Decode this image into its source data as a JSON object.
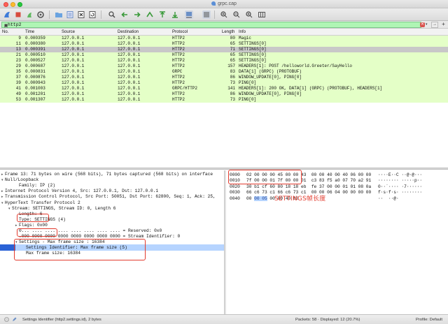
{
  "window": {
    "title": "grpc.cap"
  },
  "filter": {
    "value": "http2"
  },
  "packet_list": {
    "columns": [
      "No.",
      "Time",
      "Source",
      "Destination",
      "Protocol",
      "Length",
      "Info"
    ],
    "rows": [
      {
        "no": "9",
        "time": "0.000359",
        "src": "127.0.0.1",
        "dst": "127.0.0.1",
        "proto": "HTTP2",
        "len": "80",
        "info": "Magic"
      },
      {
        "no": "11",
        "time": "0.000380",
        "src": "127.0.0.1",
        "dst": "127.0.0.1",
        "proto": "HTTP2",
        "len": "65",
        "info": "SETTINGS[0]"
      },
      {
        "no": "13",
        "time": "0.000391",
        "src": "127.0.0.1",
        "dst": "127.0.0.1",
        "proto": "HTTP2",
        "len": "71",
        "info": "SETTINGS[0]"
      },
      {
        "no": "21",
        "time": "0.000510",
        "src": "127.0.0.1",
        "dst": "127.0.0.1",
        "proto": "HTTP2",
        "len": "65",
        "info": "SETTINGS[0]"
      },
      {
        "no": "23",
        "time": "0.000527",
        "src": "127.0.0.1",
        "dst": "127.0.0.1",
        "proto": "HTTP2",
        "len": "65",
        "info": "SETTINGS[0]"
      },
      {
        "no": "29",
        "time": "0.000687",
        "src": "127.0.0.1",
        "dst": "127.0.0.1",
        "proto": "HTTP2",
        "len": "157",
        "info": "HEADERS[1]: POST /helloworld.Greeter/SayHello"
      },
      {
        "no": "35",
        "time": "0.000831",
        "src": "127.0.0.1",
        "dst": "127.0.0.1",
        "proto": "GRPC",
        "len": "83",
        "info": "DATA[1] (GRPC) (PROTOBUF)"
      },
      {
        "no": "37",
        "time": "0.000876",
        "src": "127.0.0.1",
        "dst": "127.0.0.1",
        "proto": "HTTP2",
        "len": "86",
        "info": "WINDOW_UPDATE[0], PING[0]"
      },
      {
        "no": "39",
        "time": "0.000943",
        "src": "127.0.0.1",
        "dst": "127.0.0.1",
        "proto": "HTTP2",
        "len": "73",
        "info": "PING[0]"
      },
      {
        "no": "41",
        "time": "0.001003",
        "src": "127.0.0.1",
        "dst": "127.0.0.1",
        "proto": "GRPC/HTTP2",
        "len": "141",
        "info": "HEADERS[1]: 200 OK, DATA[1] (GRPC) (PROTOBUF), HEADERS[1]"
      },
      {
        "no": "49",
        "time": "0.001201",
        "src": "127.0.0.1",
        "dst": "127.0.0.1",
        "proto": "HTTP2",
        "len": "86",
        "info": "WINDOW_UPDATE[0], PING[0]"
      },
      {
        "no": "53",
        "time": "0.001307",
        "src": "127.0.0.1",
        "dst": "127.0.0.1",
        "proto": "HTTP2",
        "len": "73",
        "info": "PING[0]"
      }
    ]
  },
  "details": {
    "lines": [
      {
        "tri": "▸",
        "indent": 0,
        "text": "Frame 13: 71 bytes on wire (568 bits), 71 bytes captured (568 bits) on interface"
      },
      {
        "tri": "▾",
        "indent": 0,
        "text": "Null/Loopback"
      },
      {
        "tri": "",
        "indent": 2,
        "text": "Family: IP (2)"
      },
      {
        "tri": "▸",
        "indent": 0,
        "text": "Internet Protocol Version 4, Src: 127.0.0.1, Dst: 127.0.0.1"
      },
      {
        "tri": "▸",
        "indent": 0,
        "text": "Transmission Control Protocol, Src Port: 50051, Dst Port: 62800, Seq: 1, Ack: 25,"
      },
      {
        "tri": "▾",
        "indent": 0,
        "text": "HyperText Transfer Protocol 2"
      },
      {
        "tri": "▾",
        "indent": 1,
        "text": "Stream: SETTINGS, Stream ID: 0, Length 6"
      },
      {
        "tri": "",
        "indent": 2,
        "text": "Length: 6"
      },
      {
        "tri": "",
        "indent": 2,
        "text": "Type: SETTINGS (4)"
      },
      {
        "tri": "▸",
        "indent": 2,
        "text": "Flags: 0x00"
      },
      {
        "tri": "",
        "indent": 2,
        "text": "0... .... .... .... .... .... .... .... = Reserved: 0x0"
      },
      {
        "tri": "",
        "indent": 2,
        "text": ".000 0000 0000 0000 0000 0000 0000 0000 = Stream Identifier: 0"
      },
      {
        "tri": "▾",
        "indent": 2,
        "text": "Settings - Max frame size : 16384"
      },
      {
        "tri": "",
        "indent": 3,
        "text": "Settings Identifier: Max frame size (5)"
      },
      {
        "tri": "",
        "indent": 3,
        "text": "Max frame size: 16384"
      }
    ]
  },
  "hex": {
    "lines": [
      {
        "off": "0000",
        "pre": "02 00 00 00 45 00 00 43  00 00 40 00 40 06 00 00",
        "hl": "",
        "post": "",
        "ascii": "····E··C ··@·@···"
      },
      {
        "off": "0010",
        "pre": "7f 00 00 01 7f 00 00 01  c3 83 f5 a0 07 70 a2 91",
        "hl": "",
        "post": "",
        "ascii": "········ ·····p··"
      },
      {
        "off": "0020",
        "pre": "30 b1 cf 60 80 18 18 eb  fe 37 00 00 01 01 08 0a",
        "hl": "",
        "post": "",
        "ascii": "0··`···· ·7······"
      },
      {
        "off": "0030",
        "pre": "66 c6 73 c1 66 c6 73 c1  00 00 06 04 00 00 00 00",
        "hl": "",
        "post": "",
        "ascii": "f·s·f·s· ········"
      },
      {
        "off": "0040",
        "pre": "00 ",
        "hl": "00 05",
        "post": " 00 00 40 00",
        "ascii": "··  ··@·"
      }
    ]
  },
  "annotation": {
    "text": "SETTINGS帧长度"
  },
  "status": {
    "left": "Settings Identifier (http2.settings.id), 2 bytes",
    "mid": "Packets: 58 · Displayed: 12 (20.7%)",
    "right": "Profile: Default"
  },
  "colors": {
    "row_bg": "#e4ffc7",
    "selected_row": "#c8c8c8",
    "filter_ok": "#aff5b4",
    "annotation": "#e23b2e",
    "highlight": "#b6d4ff"
  }
}
